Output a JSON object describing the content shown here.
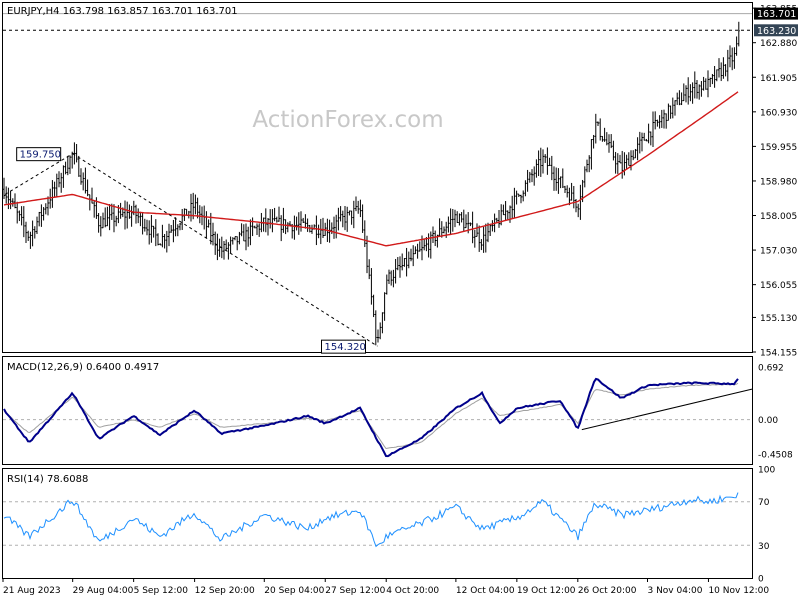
{
  "chart_data": [
    {
      "type": "ohlc",
      "header": "EURJPY,H4  163.798 163.857 163.701 163.701",
      "watermark": "ActionForex.com",
      "y_ticks": [
        "163.855",
        "162.880",
        "161.905",
        "160.930",
        "159.955",
        "158.980",
        "158.005",
        "157.030",
        "156.055",
        "155.130",
        "154.155"
      ],
      "ylim": [
        154.155,
        164.0
      ],
      "price_tags": {
        "last": "163.701",
        "level": "163.230"
      },
      "annotations": [
        {
          "label": "159.750",
          "date": "2023-08-29",
          "value": 159.75
        },
        {
          "label": "154.320",
          "date": "2023-10-03",
          "value": 154.32
        }
      ],
      "moving_average": [
        {
          "date": "2023-08-21",
          "value": 158.3
        },
        {
          "date": "2023-08-29",
          "value": 158.6
        },
        {
          "date": "2023-09-05",
          "value": 158.1
        },
        {
          "date": "2023-09-12",
          "value": 158.0
        },
        {
          "date": "2023-09-20",
          "value": 157.8
        },
        {
          "date": "2023-09-27",
          "value": 157.6
        },
        {
          "date": "2023-10-04",
          "value": 157.15
        },
        {
          "date": "2023-10-12",
          "value": 157.5
        },
        {
          "date": "2023-10-19",
          "value": 157.95
        },
        {
          "date": "2023-10-26",
          "value": 158.4
        },
        {
          "date": "2023-11-03",
          "value": 159.7
        },
        {
          "date": "2023-11-10",
          "value": 160.9
        },
        {
          "date": "2023-11-14",
          "value": 161.6
        }
      ],
      "price_path": [
        {
          "date": "2023-08-21",
          "value": 158.8
        },
        {
          "date": "2023-08-24",
          "value": 157.4
        },
        {
          "date": "2023-08-29",
          "value": 159.75
        },
        {
          "date": "2023-09-01",
          "value": 157.8
        },
        {
          "date": "2023-09-05",
          "value": 158.1
        },
        {
          "date": "2023-09-08",
          "value": 157.3
        },
        {
          "date": "2023-09-12",
          "value": 158.3
        },
        {
          "date": "2023-09-15",
          "value": 157.0
        },
        {
          "date": "2023-09-20",
          "value": 157.8
        },
        {
          "date": "2023-09-25",
          "value": 157.7
        },
        {
          "date": "2023-09-27",
          "value": 157.6
        },
        {
          "date": "2023-10-01",
          "value": 158.2
        },
        {
          "date": "2023-10-03",
          "value": 154.32
        },
        {
          "date": "2023-10-04",
          "value": 156.2
        },
        {
          "date": "2023-10-08",
          "value": 157.0
        },
        {
          "date": "2023-10-12",
          "value": 158.0
        },
        {
          "date": "2023-10-15",
          "value": 157.3
        },
        {
          "date": "2023-10-19",
          "value": 158.5
        },
        {
          "date": "2023-10-22",
          "value": 159.6
        },
        {
          "date": "2023-10-26",
          "value": 158.3
        },
        {
          "date": "2023-10-28",
          "value": 160.6
        },
        {
          "date": "2023-10-31",
          "value": 159.3
        },
        {
          "date": "2023-11-03",
          "value": 160.3
        },
        {
          "date": "2023-11-08",
          "value": 161.6
        },
        {
          "date": "2023-11-10",
          "value": 161.7
        },
        {
          "date": "2023-11-13",
          "value": 162.5
        },
        {
          "date": "2023-11-14",
          "value": 163.7
        }
      ]
    },
    {
      "type": "line",
      "header": "MACD(12,26,9) 0.6400 0.4917",
      "y_ticks": [
        "0.692",
        "0.00",
        "-0.4508"
      ],
      "ylim": [
        -0.58,
        0.82
      ],
      "series": [
        {
          "role": "macd",
          "points": [
            {
              "date": "2023-08-21",
              "value": 0.15
            },
            {
              "date": "2023-08-24",
              "value": -0.3
            },
            {
              "date": "2023-08-29",
              "value": 0.35
            },
            {
              "date": "2023-09-01",
              "value": -0.25
            },
            {
              "date": "2023-09-05",
              "value": 0.05
            },
            {
              "date": "2023-09-08",
              "value": -0.2
            },
            {
              "date": "2023-09-12",
              "value": 0.12
            },
            {
              "date": "2023-09-15",
              "value": -0.18
            },
            {
              "date": "2023-09-20",
              "value": -0.08
            },
            {
              "date": "2023-09-25",
              "value": 0.05
            },
            {
              "date": "2023-09-27",
              "value": -0.05
            },
            {
              "date": "2023-10-01",
              "value": 0.15
            },
            {
              "date": "2023-10-04",
              "value": -0.48
            },
            {
              "date": "2023-10-08",
              "value": -0.25
            },
            {
              "date": "2023-10-12",
              "value": 0.15
            },
            {
              "date": "2023-10-15",
              "value": 0.35
            },
            {
              "date": "2023-10-17",
              "value": -0.05
            },
            {
              "date": "2023-10-19",
              "value": 0.15
            },
            {
              "date": "2023-10-24",
              "value": 0.25
            },
            {
              "date": "2023-10-26",
              "value": -0.12
            },
            {
              "date": "2023-10-28",
              "value": 0.55
            },
            {
              "date": "2023-10-31",
              "value": 0.28
            },
            {
              "date": "2023-11-03",
              "value": 0.45
            },
            {
              "date": "2023-11-08",
              "value": 0.48
            },
            {
              "date": "2023-11-13",
              "value": 0.47
            },
            {
              "date": "2023-11-14",
              "value": 0.64
            }
          ]
        },
        {
          "role": "signal",
          "points": [
            {
              "date": "2023-08-21",
              "value": 0.12
            },
            {
              "date": "2023-08-24",
              "value": -0.18
            },
            {
              "date": "2023-08-29",
              "value": 0.3
            },
            {
              "date": "2023-09-01",
              "value": -0.1
            },
            {
              "date": "2023-09-05",
              "value": 0.0
            },
            {
              "date": "2023-09-08",
              "value": -0.1
            },
            {
              "date": "2023-09-12",
              "value": 0.08
            },
            {
              "date": "2023-09-15",
              "value": -0.1
            },
            {
              "date": "2023-09-20",
              "value": -0.05
            },
            {
              "date": "2023-09-25",
              "value": 0.02
            },
            {
              "date": "2023-09-27",
              "value": -0.02
            },
            {
              "date": "2023-10-01",
              "value": 0.12
            },
            {
              "date": "2023-10-04",
              "value": -0.38
            },
            {
              "date": "2023-10-08",
              "value": -0.3
            },
            {
              "date": "2023-10-12",
              "value": 0.08
            },
            {
              "date": "2023-10-15",
              "value": 0.28
            },
            {
              "date": "2023-10-17",
              "value": 0.05
            },
            {
              "date": "2023-10-19",
              "value": 0.1
            },
            {
              "date": "2023-10-24",
              "value": 0.2
            },
            {
              "date": "2023-10-26",
              "value": -0.05
            },
            {
              "date": "2023-10-28",
              "value": 0.4
            },
            {
              "date": "2023-10-31",
              "value": 0.32
            },
            {
              "date": "2023-11-03",
              "value": 0.4
            },
            {
              "date": "2023-11-08",
              "value": 0.45
            },
            {
              "date": "2023-11-13",
              "value": 0.46
            },
            {
              "date": "2023-11-14",
              "value": 0.49
            }
          ]
        }
      ]
    },
    {
      "type": "line",
      "header": "RSI(14) 78.6088",
      "y_ticks": [
        "100",
        "70",
        "30",
        "0"
      ],
      "ylim": [
        0,
        100
      ],
      "levels": [
        70,
        30
      ],
      "series": [
        {
          "role": "rsi",
          "points": [
            {
              "date": "2023-08-21",
              "value": 58
            },
            {
              "date": "2023-08-24",
              "value": 38
            },
            {
              "date": "2023-08-29",
              "value": 72
            },
            {
              "date": "2023-09-01",
              "value": 33
            },
            {
              "date": "2023-09-05",
              "value": 55
            },
            {
              "date": "2023-09-08",
              "value": 38
            },
            {
              "date": "2023-09-12",
              "value": 60
            },
            {
              "date": "2023-09-15",
              "value": 35
            },
            {
              "date": "2023-09-20",
              "value": 58
            },
            {
              "date": "2023-09-25",
              "value": 45
            },
            {
              "date": "2023-09-27",
              "value": 55
            },
            {
              "date": "2023-10-01",
              "value": 62
            },
            {
              "date": "2023-10-03",
              "value": 28
            },
            {
              "date": "2023-10-04",
              "value": 38
            },
            {
              "date": "2023-10-08",
              "value": 50
            },
            {
              "date": "2023-10-12",
              "value": 65
            },
            {
              "date": "2023-10-15",
              "value": 45
            },
            {
              "date": "2023-10-19",
              "value": 55
            },
            {
              "date": "2023-10-22",
              "value": 70
            },
            {
              "date": "2023-10-26",
              "value": 38
            },
            {
              "date": "2023-10-28",
              "value": 68
            },
            {
              "date": "2023-10-31",
              "value": 58
            },
            {
              "date": "2023-11-03",
              "value": 62
            },
            {
              "date": "2023-11-08",
              "value": 72
            },
            {
              "date": "2023-11-10",
              "value": 70
            },
            {
              "date": "2023-11-13",
              "value": 75
            },
            {
              "date": "2023-11-14",
              "value": 84
            }
          ]
        }
      ]
    }
  ],
  "x_axis": {
    "ticks": [
      "21 Aug 2023",
      "29 Aug 04:00",
      "5 Sep 12:00",
      "12 Sep 20:00",
      "20 Sep 04:00",
      "27 Sep 12:00",
      "4 Oct 20:00",
      "12 Oct 04:00",
      "19 Oct 12:00",
      "26 Oct 20:00",
      "3 Nov 04:00",
      "10 Nov 12:00"
    ],
    "tick_dates": [
      "2023-08-21",
      "2023-08-29",
      "2023-09-05",
      "2023-09-12",
      "2023-09-20",
      "2023-09-27",
      "2023-10-04",
      "2023-10-12",
      "2023-10-19",
      "2023-10-26",
      "2023-11-03",
      "2023-11-10"
    ],
    "xlim": [
      "2023-08-21",
      "2023-11-15"
    ]
  },
  "colors": {
    "price": "#000000",
    "moving_average": "#d11a1a",
    "macd": "#00008b",
    "signal": "#a0a0a0",
    "rsi": "#1e90ff",
    "trend": "#000000",
    "grid": "#b0b0b0",
    "tag_last": "#000000",
    "tag_level": "#334455",
    "watermark": "#c8c8c8"
  }
}
